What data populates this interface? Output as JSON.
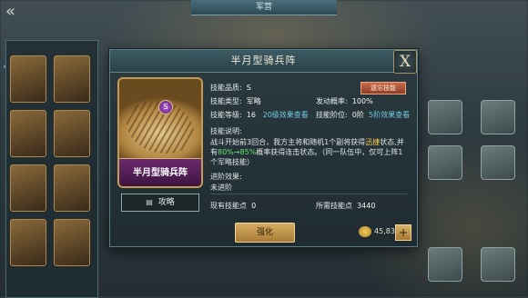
{
  "topbar": {
    "title": "军营"
  },
  "dialog": {
    "title": "半月型骑兵阵",
    "close_label": "X",
    "card": {
      "name": "半月型骑兵阵",
      "gem_label": "S"
    },
    "strategy_label": "攻略",
    "grade": {
      "label": "技能品质:",
      "value": "S"
    },
    "type": {
      "label": "技能类型:",
      "value": "军略"
    },
    "rate": {
      "label": "发动概率:",
      "value": "100%"
    },
    "level": {
      "label": "技能等级:",
      "value": "16",
      "link": "20级效果查看"
    },
    "stage": {
      "label": "技能阶位:",
      "value": "0阶",
      "link": "5阶效果查看"
    },
    "source_tag": "遗忘技能",
    "desc_label": "技能说明:",
    "desc_part1": "战斗开始前3回合，我方主将和随机1个副将获得",
    "desc_keyword": "迅捷",
    "desc_part2": "状态,并有",
    "desc_pct": "80%→85%",
    "desc_part3": "概率获得连击状态。（同一队伍中，仅可上阵1个军略技能）",
    "advance_label": "进阶效果:",
    "advance_value": "未进阶",
    "have_points": {
      "label": "现有技能点",
      "value": "0"
    },
    "need_points": {
      "label": "所需技能点",
      "value": "3440"
    },
    "upgrade_label": "强化",
    "gold": "45,835",
    "plus_label": "+"
  },
  "colors": {
    "accent_gold": "#d6ad64",
    "link_blue": "#72c9e0",
    "highlight_green": "#6fe073",
    "highlight_yellow": "#f2d048"
  }
}
